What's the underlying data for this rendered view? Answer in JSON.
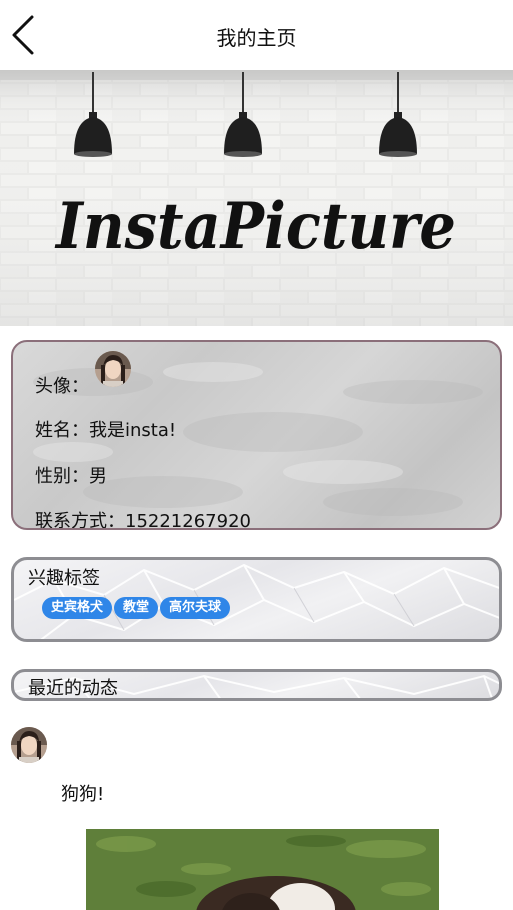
{
  "nav": {
    "title": "我的主页"
  },
  "banner": {
    "brand_text": "InstaPicture"
  },
  "profile": {
    "avatar_label": "头像：",
    "name_label": "姓名：",
    "name_value": "我是insta!",
    "gender_label": "性别：",
    "gender_value": "男",
    "contact_label": "联系方式：",
    "contact_value": "15221267920"
  },
  "interests": {
    "title": "兴趣标签",
    "tags": [
      "史宾格犬",
      "教堂",
      "高尔夫球"
    ]
  },
  "moments": {
    "title": "最近的动态",
    "posts": [
      {
        "text": "狗狗!"
      }
    ]
  },
  "colors": {
    "tag_bg": "#2f86e8",
    "profile_border": "#8b6f7a",
    "card_border": "#8d8d92"
  }
}
